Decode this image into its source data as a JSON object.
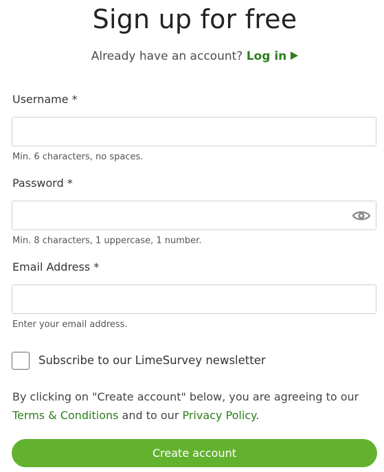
{
  "header": {
    "title": "Sign up for free",
    "subtitle_prefix": "Already have an account?",
    "login_link": "Log in"
  },
  "form": {
    "username": {
      "label": "Username *",
      "value": "",
      "placeholder": "",
      "hint": "Min. 6 characters, no spaces."
    },
    "password": {
      "label": "Password *",
      "value": "",
      "placeholder": "",
      "hint": "Min. 8 characters, 1 uppercase, 1 number.",
      "toggle_icon": "eye-icon"
    },
    "email": {
      "label": "Email Address *",
      "value": "",
      "placeholder": "",
      "hint": "Enter your email address."
    },
    "newsletter": {
      "label": "Subscribe to our LimeSurvey newsletter",
      "checked": false
    },
    "terms": {
      "prefix": "By clicking on \"Create account\" below, you are agreeing to our",
      "terms_link": "Terms & Conditions",
      "middle": "and to our",
      "privacy_link": "Privacy Policy",
      "suffix": "."
    },
    "submit_label": "Create account"
  },
  "colors": {
    "accent": "#63b22f",
    "link": "#2e7d1e",
    "border": "#cfcfcf"
  }
}
